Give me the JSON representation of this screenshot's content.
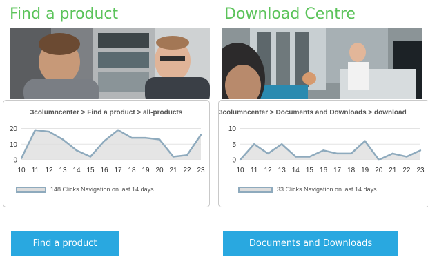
{
  "panels": [
    {
      "heading": "Find a product",
      "breadcrumb": "3columncenter > Find a product > all-products",
      "legend_text": "148 Clicks Navigation on last 14 days",
      "button_label": "Find a product"
    },
    {
      "heading": "Download Centre",
      "breadcrumb": "3columncenter > Documents and Downloads > download",
      "legend_text": "33 Clicks Navigation on last 14 days",
      "button_label": "Documents and Downloads"
    }
  ],
  "colors": {
    "heading": "#5bc35a",
    "button": "#29a8e0",
    "line": "#8eaabd",
    "area": "#dcdcdc"
  },
  "chart_data": [
    {
      "type": "area",
      "x": [
        10,
        11,
        12,
        13,
        14,
        15,
        16,
        17,
        18,
        19,
        20,
        21,
        22,
        23
      ],
      "values": [
        1,
        19,
        18,
        13,
        6,
        2,
        12,
        19,
        14,
        14,
        13,
        2,
        3,
        16
      ],
      "yticks": [
        0,
        10,
        20
      ],
      "ylim": [
        0,
        22
      ],
      "grid": true,
      "legend": "bottom"
    },
    {
      "type": "area",
      "x": [
        10,
        11,
        12,
        13,
        14,
        15,
        16,
        17,
        18,
        19,
        20,
        21,
        22,
        23
      ],
      "values": [
        0,
        5,
        2,
        5,
        1,
        1,
        3,
        2,
        2,
        6,
        0,
        2,
        1,
        3
      ],
      "yticks": [
        0,
        5,
        10
      ],
      "ylim": [
        0,
        11
      ],
      "grid": true,
      "legend": "bottom"
    }
  ]
}
